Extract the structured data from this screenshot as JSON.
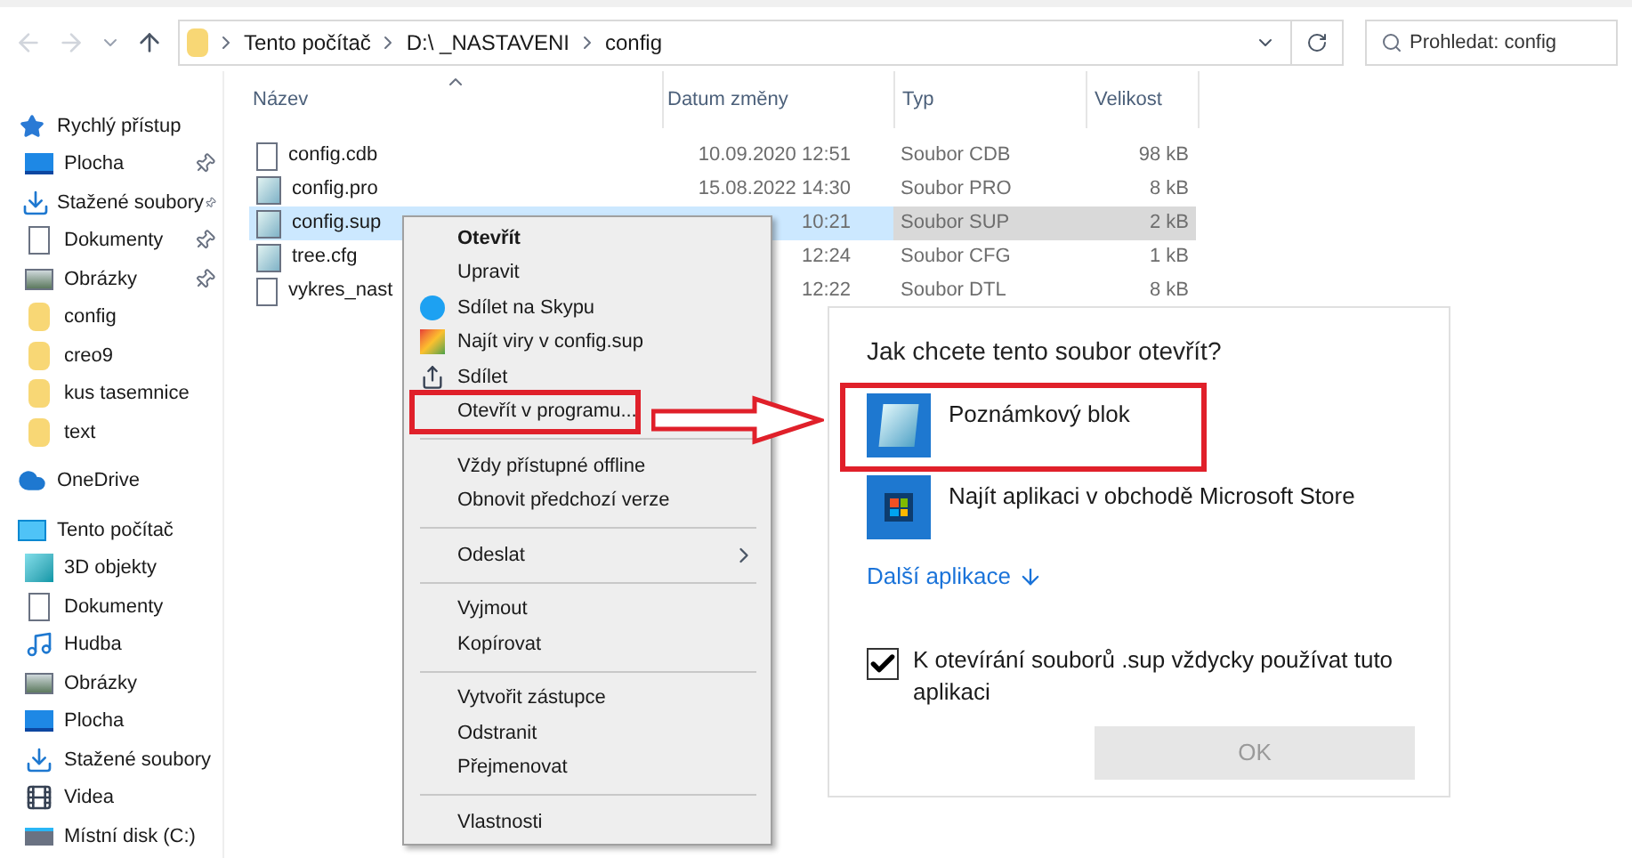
{
  "address": {
    "segments": [
      "Tento počítač",
      "D:\\ _NASTAVENI",
      "config"
    ]
  },
  "search": {
    "placeholder": "Prohledat: config"
  },
  "sidebar": [
    {
      "label": "Rychlý přístup",
      "children": [
        {
          "label": "Plocha",
          "pinned": true
        },
        {
          "label": "Stažené soubory",
          "pinned": true
        },
        {
          "label": "Dokumenty",
          "pinned": true
        },
        {
          "label": "Obrázky",
          "pinned": true
        },
        {
          "label": "config",
          "pinned": false
        },
        {
          "label": "creo9",
          "pinned": false
        },
        {
          "label": "kus tasemnice",
          "pinned": false
        },
        {
          "label": "text",
          "pinned": false
        }
      ]
    },
    {
      "label": "OneDrive"
    },
    {
      "label": "Tento počítač",
      "children": [
        {
          "label": "3D objekty",
          "pinned": false
        },
        {
          "label": "Dokumenty",
          "pinned": false
        },
        {
          "label": "Hudba",
          "pinned": false
        },
        {
          "label": "Obrázky",
          "pinned": false
        },
        {
          "label": "Plocha",
          "pinned": false
        },
        {
          "label": "Stažené soubory",
          "pinned": false
        },
        {
          "label": "Videa",
          "pinned": false
        },
        {
          "label": "Místní disk (C:)",
          "pinned": false
        }
      ]
    }
  ],
  "table": {
    "columns": [
      "Název",
      "Datum změny",
      "Typ",
      "Velikost"
    ],
    "rows": [
      {
        "name": "config.cdb",
        "date": "10.09.2020 12:51",
        "type": "Soubor CDB",
        "size": "98 kB",
        "selected": false
      },
      {
        "name": "config.pro",
        "date": "15.08.2022 14:30",
        "type": "Soubor PRO",
        "size": "8 kB",
        "selected": false
      },
      {
        "name": "config.sup",
        "date": "10:21",
        "type": "Soubor SUP",
        "size": "2 kB",
        "selected": true
      },
      {
        "name": "tree.cfg",
        "date": "12:24",
        "type": "Soubor CFG",
        "size": "1 kB",
        "selected": false
      },
      {
        "name": "vykres_nast",
        "date": "12:22",
        "type": "Soubor DTL",
        "size": "8 kB",
        "selected": false
      }
    ]
  },
  "context_menu": [
    {
      "kind": "item",
      "label": "Otevřít",
      "default": true
    },
    {
      "kind": "item",
      "label": "Upravit"
    },
    {
      "kind": "item",
      "label": "Sdílet na Skypu"
    },
    {
      "kind": "item",
      "label": "Najít viry v config.sup"
    },
    {
      "kind": "item",
      "label": "Sdílet"
    },
    {
      "kind": "item",
      "label": "Otevřít v programu...",
      "highlighted": true
    },
    {
      "kind": "separator"
    },
    {
      "kind": "item",
      "label": "Vždy přístupné offline"
    },
    {
      "kind": "item",
      "label": "Obnovit předchozí verze"
    },
    {
      "kind": "separator"
    },
    {
      "kind": "item",
      "label": "Odeslat",
      "submenu": true
    },
    {
      "kind": "separator"
    },
    {
      "kind": "item",
      "label": "Vyjmout"
    },
    {
      "kind": "item",
      "label": "Kopírovat"
    },
    {
      "kind": "separator"
    },
    {
      "kind": "item",
      "label": "Vytvořit zástupce"
    },
    {
      "kind": "item",
      "label": "Odstranit"
    },
    {
      "kind": "item",
      "label": "Přejmenovat"
    },
    {
      "kind": "separator"
    },
    {
      "kind": "item",
      "label": "Vlastnosti"
    }
  ],
  "open_with": {
    "title": "Jak chcete tento soubor otevřít?",
    "apps": [
      {
        "label": "Poznámkový blok",
        "highlighted": true
      },
      {
        "label": "Najít aplikaci v obchodě Microsoft Store",
        "highlighted": false
      }
    ],
    "more_link": "Další aplikace",
    "always_use": {
      "label": "K otevírání souborů .sup vždycky používat tuto aplikaci",
      "checked": true
    },
    "ok_button": {
      "label": "OK",
      "disabled": true
    }
  }
}
